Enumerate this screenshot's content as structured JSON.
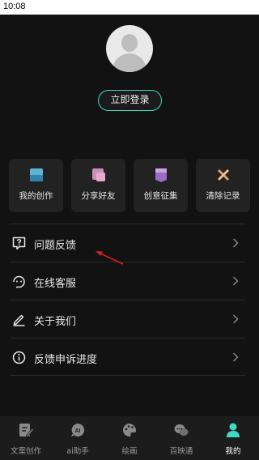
{
  "statusbar": {
    "time": "10:08"
  },
  "profile": {
    "login_label": "立即登录"
  },
  "quick_actions": [
    {
      "label": "我的创作",
      "icon": "document-folder-icon"
    },
    {
      "label": "分享好友",
      "icon": "share-icon"
    },
    {
      "label": "创意征集",
      "icon": "banner-icon"
    },
    {
      "label": "清除记录",
      "icon": "clear-tools-icon"
    }
  ],
  "menu": [
    {
      "label": "问题反馈",
      "icon": "feedback-question-icon"
    },
    {
      "label": "在线客服",
      "icon": "customer-service-icon"
    },
    {
      "label": "关于我们",
      "icon": "edit-pen-icon"
    },
    {
      "label": "反馈申诉进度",
      "icon": "info-icon"
    }
  ],
  "tabbar": [
    {
      "label": "文案创作",
      "icon": "write-icon",
      "active": false
    },
    {
      "label": "ai助手",
      "icon": "ai-chat-icon",
      "active": false
    },
    {
      "label": "绘画",
      "icon": "palette-icon",
      "active": false
    },
    {
      "label": "百映通",
      "icon": "chat-bubbles-icon",
      "active": false
    },
    {
      "label": "我的",
      "icon": "person-icon",
      "active": true
    }
  ],
  "colors": {
    "accent": "#3fd8c2",
    "background": "#121212",
    "card": "#222222",
    "annotation_arrow": "#d42020"
  }
}
